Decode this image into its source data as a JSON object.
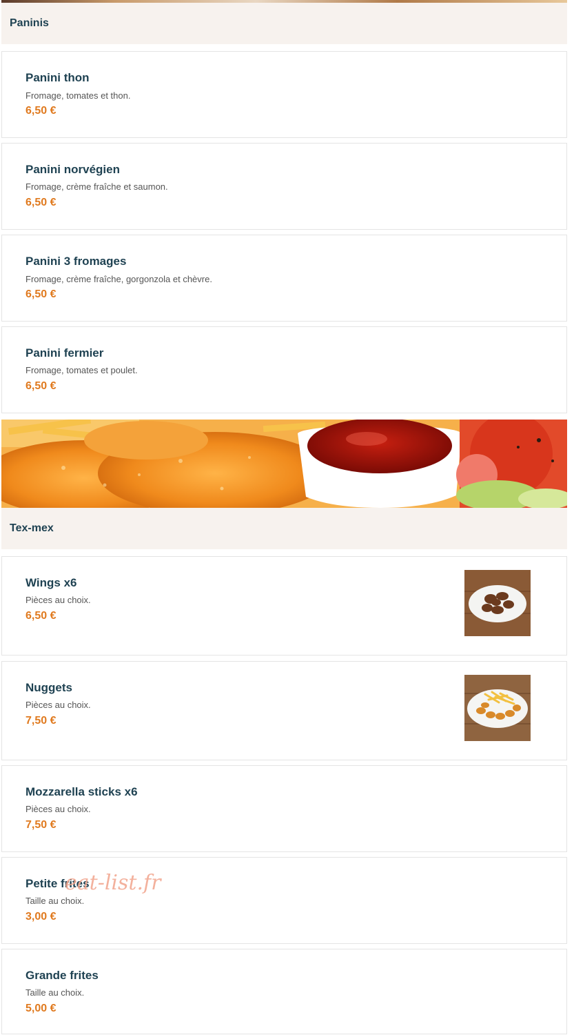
{
  "sections": [
    {
      "title": "Paninis",
      "items": [
        {
          "name": "Panini thon",
          "desc": "Fromage, tomates et thon.",
          "price": "6,50 €"
        },
        {
          "name": "Panini norvégien",
          "desc": "Fromage, crème fraîche et saumon.",
          "price": "6,50 €"
        },
        {
          "name": "Panini 3 fromages",
          "desc": "Fromage, crème fraîche, gorgonzola et chèvre.",
          "price": "6,50 €"
        },
        {
          "name": "Panini fermier",
          "desc": "Fromage, tomates et poulet.",
          "price": "6,50 €"
        }
      ]
    },
    {
      "title": "Tex-mex",
      "items": [
        {
          "name": "Wings x6",
          "desc": "Pièces au choix.",
          "price": "6,50 €"
        },
        {
          "name": "Nuggets",
          "desc": "Pièces au choix.",
          "price": "7,50 €"
        },
        {
          "name": "Mozzarella sticks x6",
          "desc": "Pièces au choix.",
          "price": "7,50 €"
        },
        {
          "name": "Petite frites",
          "desc": "Taille au choix.",
          "price": "3,00 €"
        },
        {
          "name": "Grande frites",
          "desc": "Taille au choix.",
          "price": "5,00 €"
        }
      ]
    }
  ],
  "watermark": "eat-list.fr",
  "colors": {
    "title": "#1f4252",
    "price": "#e07a1f",
    "header_bg": "#f7f2ee",
    "border": "#e4e4e4"
  }
}
